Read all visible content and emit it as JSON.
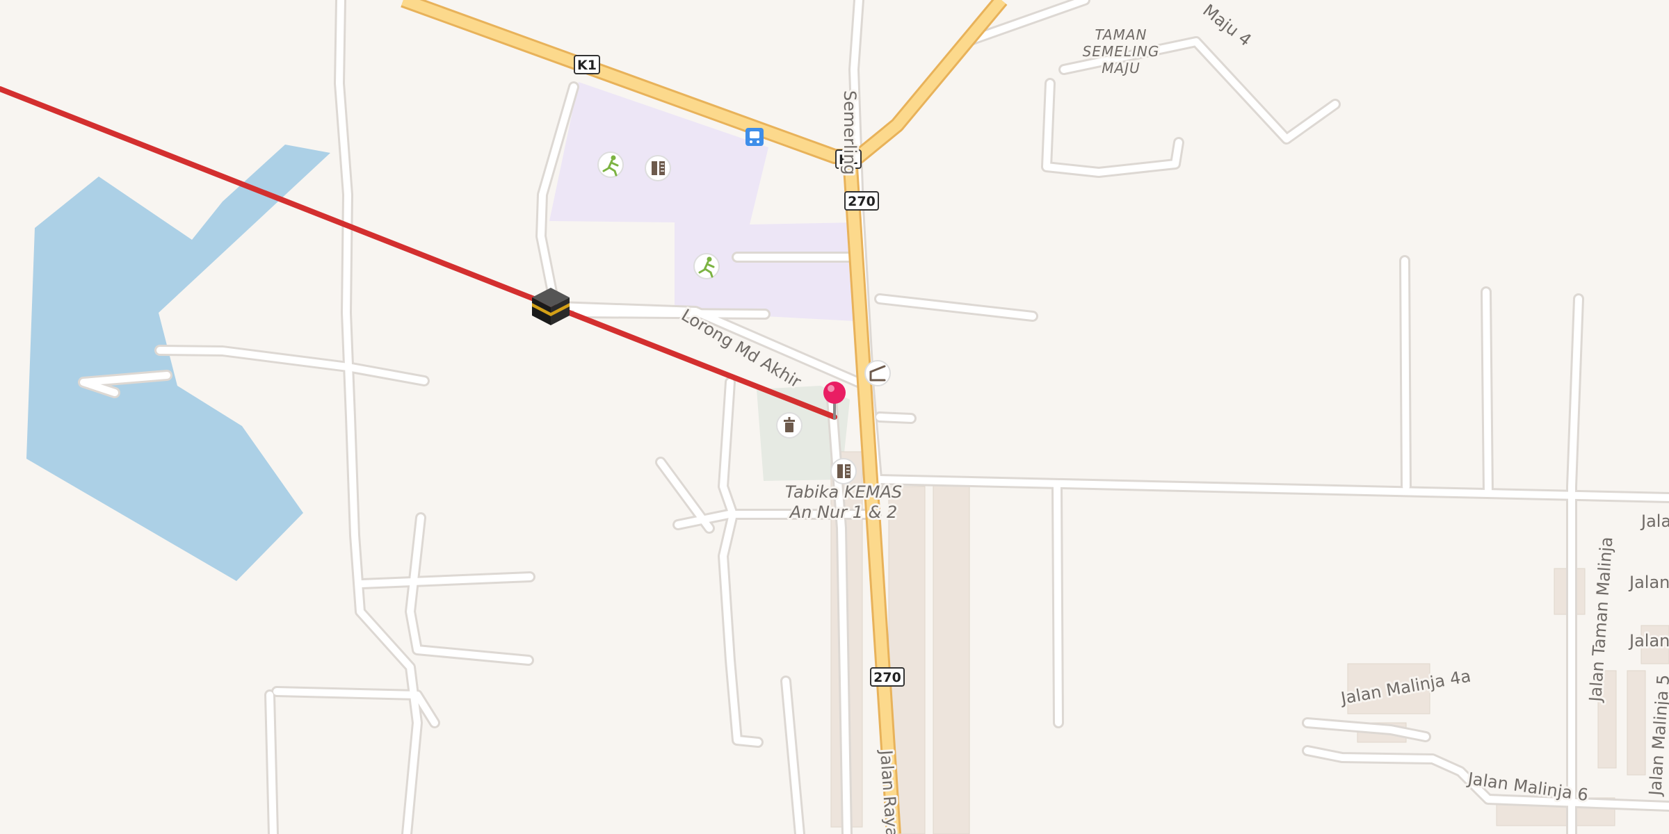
{
  "map": {
    "street_labels": {
      "semerling": "Semerling",
      "lorong_md_akhir": "Lorong Md Akhir",
      "maju_4": "Maju 4",
      "jalan_raya": "Jalan Raya",
      "jalan_taman_malinja": "Jalan Taman Malinja",
      "jalan_malinja_4a": "Jalan Malinja 4a",
      "jalan_malinja_6": "Jalan Malinja 6",
      "jalan_malinja_5": "Jalan Malinja 5",
      "jala_1": "Jala",
      "jalan_2": "Jalan",
      "jalan_3": "Jalan"
    },
    "place_labels": {
      "taman_line1": "TAMAN",
      "taman_line2": "SEMELING",
      "taman_line3": "MAJU",
      "tabika_line1": "Tabika KEMAS",
      "tabika_line2": "An Nur 1 & 2"
    },
    "road_shields": {
      "k1_a": "K1",
      "k1_b": "K1",
      "r270_a": "270",
      "r270_b": "270"
    },
    "colors": {
      "land": "#f8f5f1",
      "water": "#acd0e6",
      "park": "#ede6f6",
      "green_area": "#e6eae3",
      "building": "#ede4dc",
      "road_minor": "#ffffff",
      "road_casing": "#ddd8d3",
      "road_major": "#fcd98c",
      "road_major_casing": "#e8b25a",
      "qibla_line": "#d32f2f",
      "pin": "#e91e63",
      "bus_stop": "#3e8ee9",
      "poi_green": "#7cb342",
      "poi_brown": "#6d5a4c"
    },
    "icons": [
      "kaaba-icon",
      "location-pin-icon",
      "bus-stop-icon",
      "sports-icon",
      "school-icon",
      "cemetery-icon",
      "shelter-icon"
    ]
  }
}
